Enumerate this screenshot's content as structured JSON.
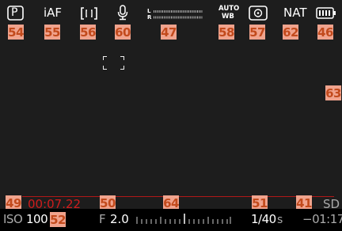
{
  "top_icons": {
    "mode_label": "P",
    "autofocus_mode": "iAF",
    "audio_meter_left": "L",
    "audio_meter_right": "R",
    "white_balance_line1": "AUTO",
    "white_balance_line2": "WB",
    "film_style": "NAT"
  },
  "badges": {
    "b54": "54",
    "b55": "55",
    "b56": "56",
    "b60": "60",
    "b47": "47",
    "b58": "58",
    "b57": "57",
    "b62": "62",
    "b46": "46",
    "b63": "63",
    "b49": "49",
    "b50": "50",
    "b64": "64",
    "b51": "51",
    "b41": "41",
    "b52": "52"
  },
  "bottom": {
    "recording_time": "00:07.22",
    "iso_label": "ISO",
    "iso_value": "100",
    "aperture_label": "F",
    "aperture_value": "2.0",
    "shutter_speed": "1/40",
    "shutter_unit": "s",
    "storage": "SD",
    "remaining_time": "−01:17"
  },
  "colors": {
    "recording_red": "#d01c1c",
    "badge_bg": "#f0a38d",
    "badge_text": "#c24a1c"
  }
}
